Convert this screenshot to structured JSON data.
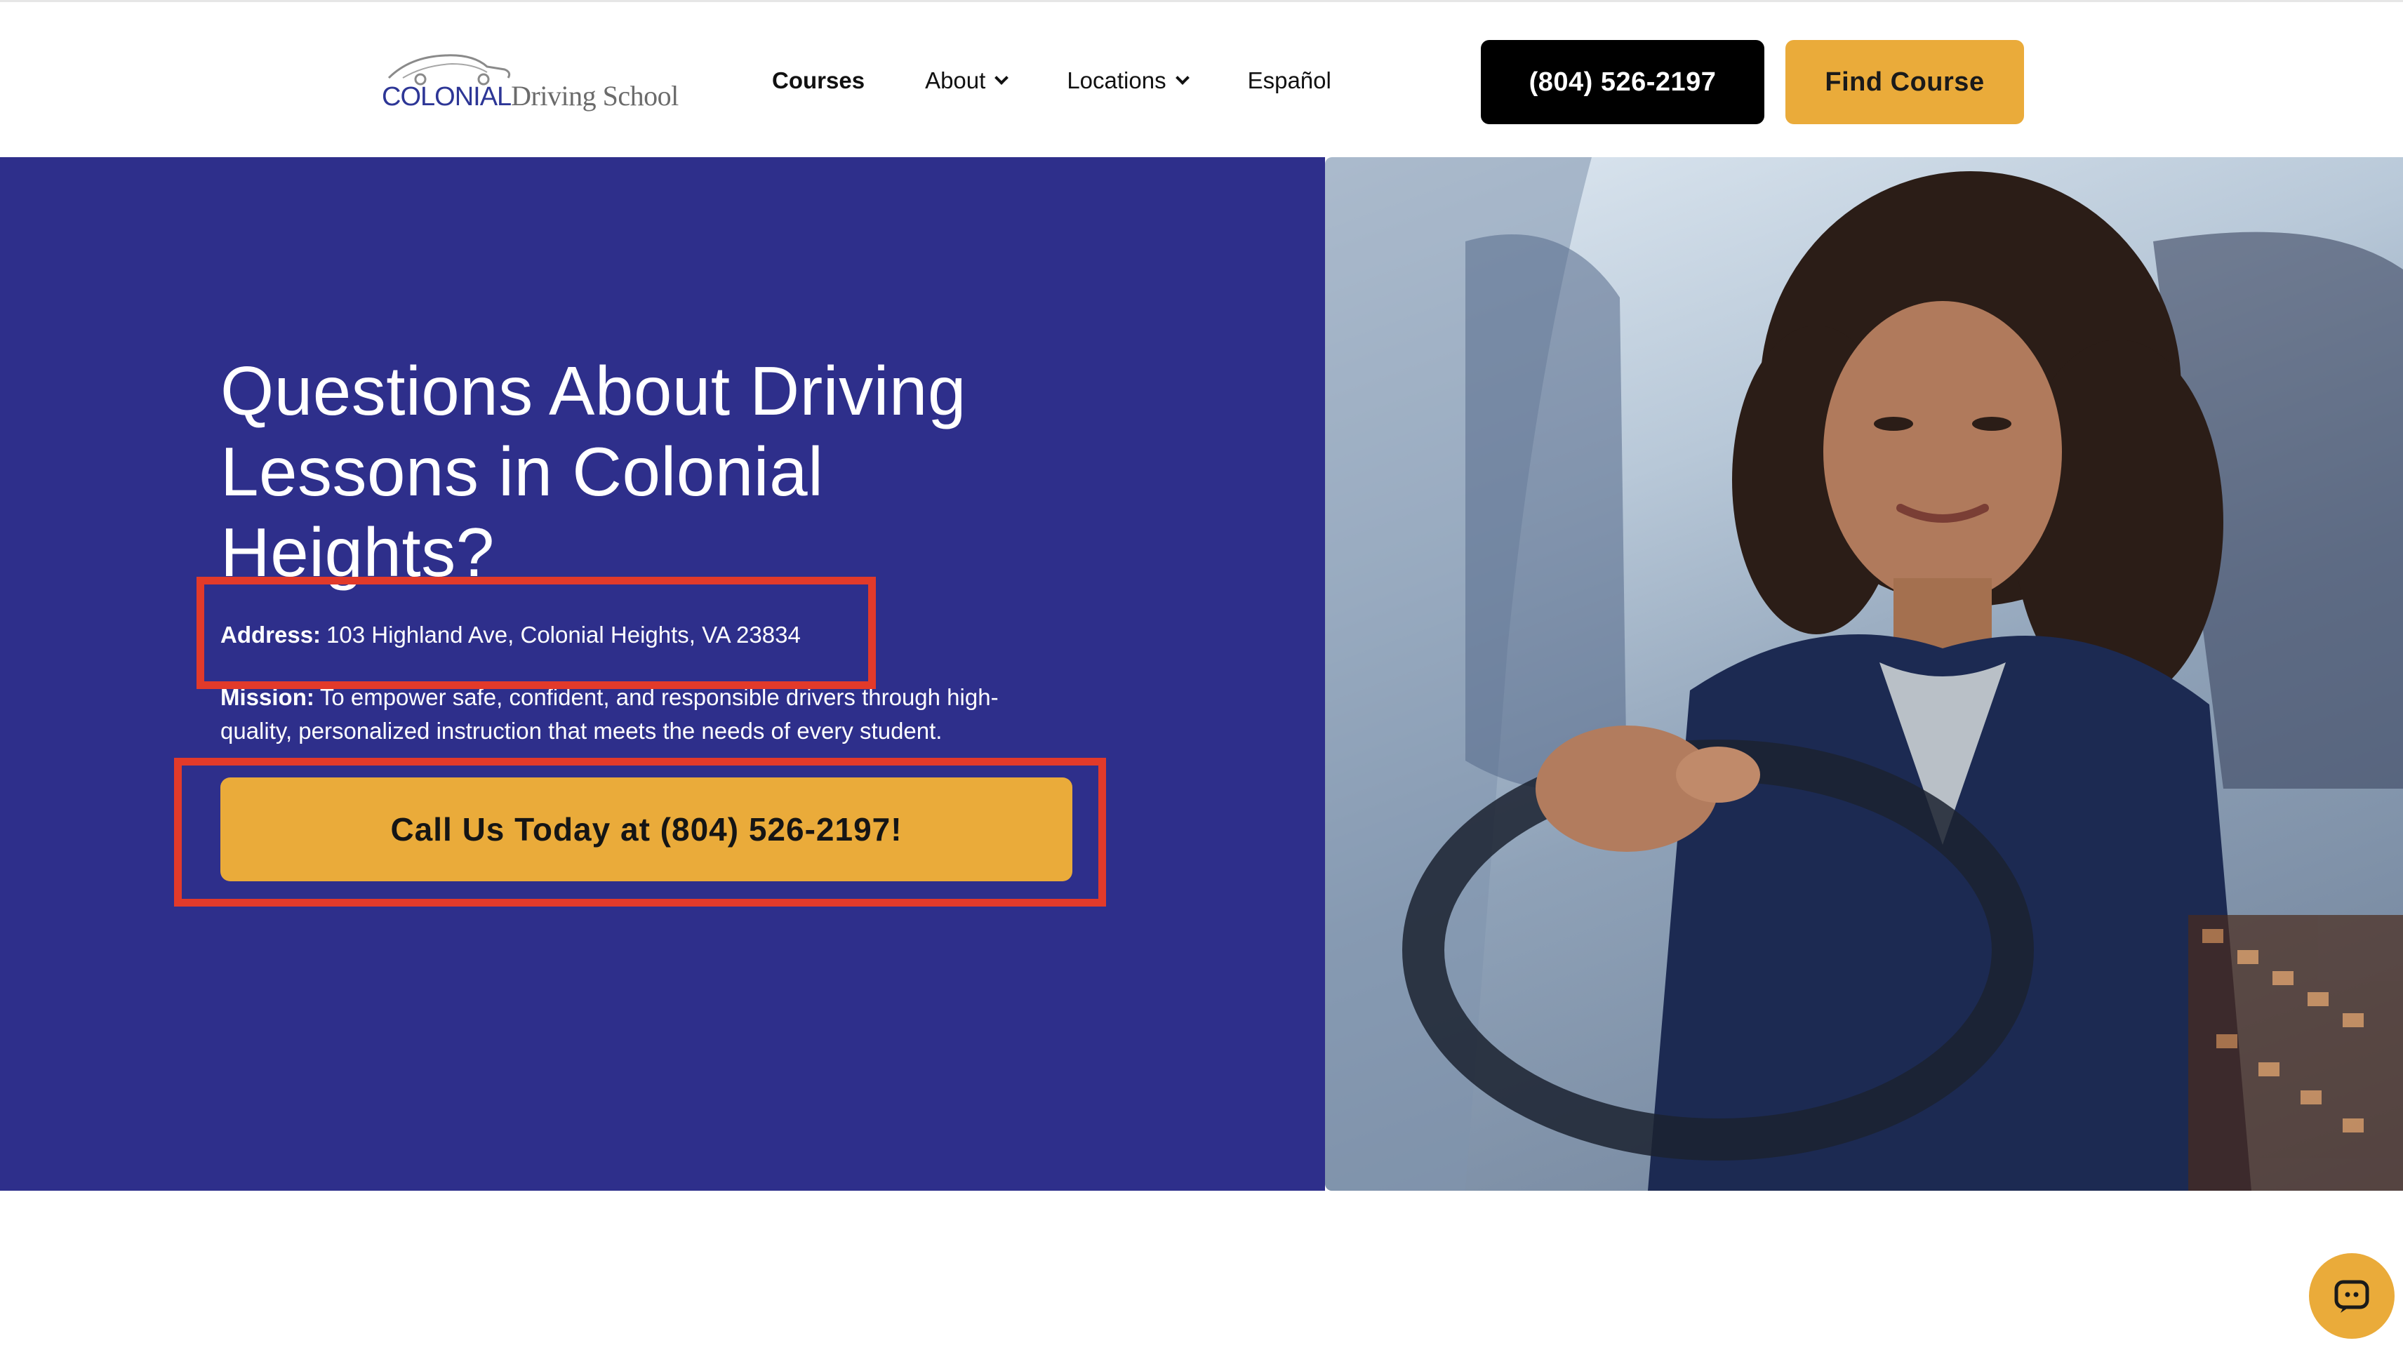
{
  "header": {
    "logo": {
      "brand_primary": "COLONIAL",
      "brand_secondary": "Driving School",
      "icon": "car-logo-icon"
    },
    "nav": [
      {
        "label": "Courses",
        "has_dropdown": false
      },
      {
        "label": "About",
        "has_dropdown": true
      },
      {
        "label": "Locations",
        "has_dropdown": true
      },
      {
        "label": "Español",
        "has_dropdown": false
      }
    ],
    "phone_button": "(804) 526-2197",
    "find_course_button": "Find Course"
  },
  "hero": {
    "title": "Questions About Driving Lessons in Colonial Heights?",
    "address_label": "Address:",
    "address_value": "103 Highland Ave, Colonial Heights, VA 23834",
    "mission_label": "Mission:",
    "mission_value": "To empower safe, confident, and responsible drivers through high-quality, personalized instruction that meets the needs of every student.",
    "cta_button": "Call Us Today at (804) 526-2197!",
    "photo_icon": "woman-driving-photo"
  },
  "chat": {
    "icon": "chat-bubble-icon"
  },
  "colors": {
    "hero_bg": "#2e2f8b",
    "accent": "#eaab3a",
    "phone_button_bg": "#000000",
    "highlight": "#e23a2a"
  }
}
